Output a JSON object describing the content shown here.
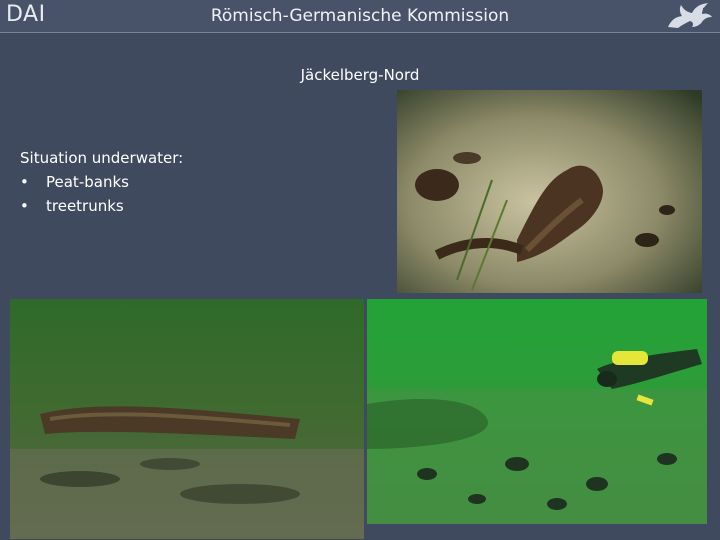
{
  "header": {
    "logo_text": "DAI",
    "title": "Römisch-Germanische Kommission",
    "emblem_icon": "griffin-emblem-icon"
  },
  "slide": {
    "title": "Jäckelberg-Nord",
    "intro": "Situation underwater:",
    "bullets": [
      {
        "symbol": "•",
        "label": "Peat-banks"
      },
      {
        "symbol": "•",
        "label": "treetrunks"
      }
    ]
  },
  "colors": {
    "background": "#3f4a5f",
    "header": "#48536a",
    "text": "#ffffff"
  }
}
